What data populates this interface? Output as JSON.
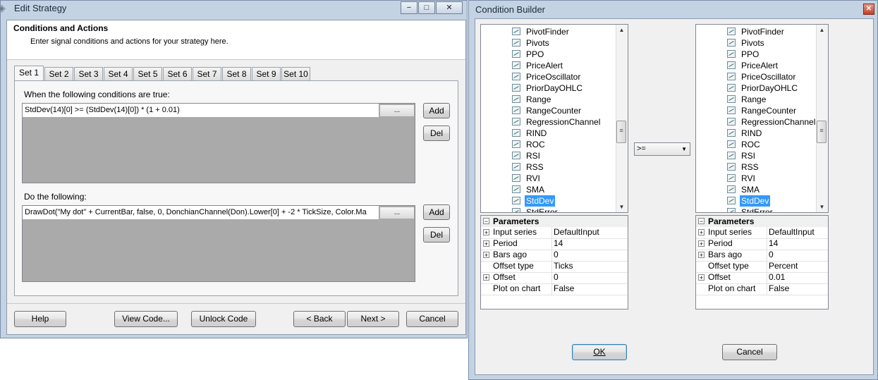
{
  "edit_strategy": {
    "title": "Edit Strategy",
    "caption_buttons": [
      "−",
      "□",
      "✕"
    ],
    "header_title": "Conditions and Actions",
    "header_subtitle": "Enter signal conditions and actions for your strategy here.",
    "tabs": [
      "Set 1",
      "Set 2",
      "Set 3",
      "Set 4",
      "Set 5",
      "Set 6",
      "Set 7",
      "Set 8",
      "Set 9",
      "Set 10"
    ],
    "active_tab": "Set 1",
    "conditions_label": "When the following conditions are true:",
    "condition_text": "StdDev(14)[0] >= (StdDev(14)[0]) * (1 + 0.01)",
    "actions_label": "Do the following:",
    "action_text": "DrawDot(\"My dot\" + CurrentBar, false, 0, DonchianChannel(Don).Lower[0] + -2 * TickSize, Color.Ma",
    "ellipsis_label": "...",
    "add_label": "Add",
    "del_label": "Del",
    "footer": {
      "help": "Help",
      "view_code": "View Code...",
      "unlock_code": "Unlock Code",
      "back": "< Back",
      "next": "Next >",
      "cancel": "Cancel"
    }
  },
  "condition_builder": {
    "title": "Condition Builder",
    "close_glyph": "✕",
    "left_list": {
      "items": [
        "PivotFinder",
        "Pivots",
        "PPO",
        "PriceAlert",
        "PriceOscillator",
        "PriorDayOHLC",
        "Range",
        "RangeCounter",
        "RegressionChannel",
        "RIND",
        "ROC",
        "RSI",
        "RSS",
        "RVI",
        "SMA",
        "StdDev",
        "StdError"
      ],
      "selected": "StdDev"
    },
    "right_list": {
      "items": [
        "PivotFinder",
        "Pivots",
        "PPO",
        "PriceAlert",
        "PriceOscillator",
        "PriorDayOHLC",
        "Range",
        "RangeCounter",
        "RegressionChannel",
        "RIND",
        "ROC",
        "RSI",
        "RSS",
        "RVI",
        "SMA",
        "StdDev",
        "StdError"
      ],
      "selected": "StdDev"
    },
    "operator": ">=",
    "left_params": {
      "header": "Parameters",
      "rows": [
        {
          "key": "Input series",
          "value": "DefaultInput",
          "expandable": true
        },
        {
          "key": "Period",
          "value": "14",
          "expandable": true
        },
        {
          "key": "Bars ago",
          "value": "0",
          "expandable": true
        },
        {
          "key": "Offset type",
          "value": "Ticks",
          "expandable": false
        },
        {
          "key": "Offset",
          "value": "0",
          "expandable": true
        },
        {
          "key": "Plot on chart",
          "value": "False",
          "expandable": false
        }
      ]
    },
    "right_params": {
      "header": "Parameters",
      "rows": [
        {
          "key": "Input series",
          "value": "DefaultInput",
          "expandable": true
        },
        {
          "key": "Period",
          "value": "14",
          "expandable": true
        },
        {
          "key": "Bars ago",
          "value": "0",
          "expandable": true
        },
        {
          "key": "Offset type",
          "value": "Percent",
          "expandable": false
        },
        {
          "key": "Offset",
          "value": "0.01",
          "expandable": true
        },
        {
          "key": "Plot on chart",
          "value": "False",
          "expandable": false
        }
      ]
    },
    "ok_label": "OK",
    "cancel_label": "Cancel"
  }
}
